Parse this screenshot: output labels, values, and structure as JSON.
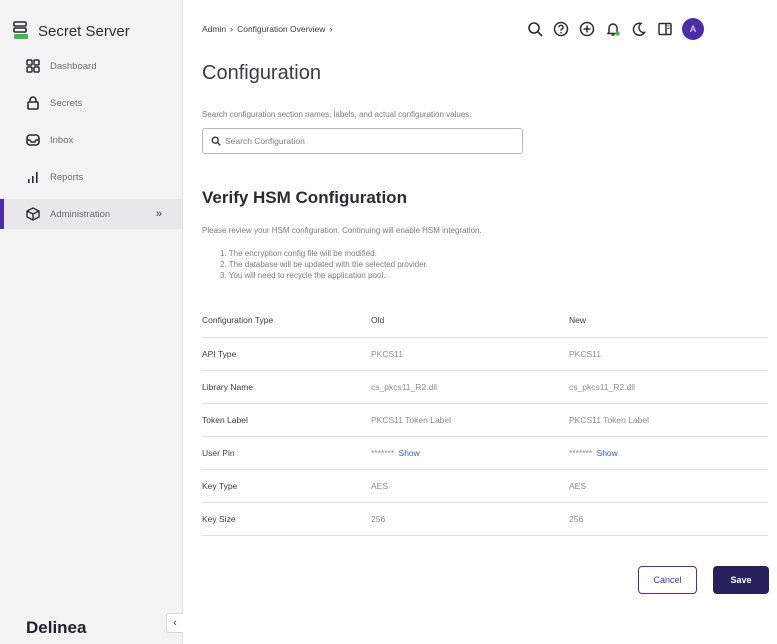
{
  "app": {
    "name": "Secret Server",
    "footer_logo": "Delinea"
  },
  "sidebar": {
    "items": [
      {
        "label": "Dashboard",
        "icon": "dashboard-icon"
      },
      {
        "label": "Secrets",
        "icon": "lock-icon"
      },
      {
        "label": "Inbox",
        "icon": "inbox-icon"
      },
      {
        "label": "Reports",
        "icon": "bar-chart-icon"
      },
      {
        "label": "Administration",
        "icon": "cube-icon",
        "active": true,
        "chevron": "»"
      }
    ],
    "collapse_label": "‹"
  },
  "breadcrumb": [
    "Admin",
    "Configuration Overview"
  ],
  "header": {
    "avatar_initial": "A"
  },
  "page": {
    "title": "Configuration",
    "search_description": "Search configuration section names, labels, and actual configuration values.",
    "search_placeholder": "Search Configuration"
  },
  "hsm": {
    "title": "Verify HSM Configuration",
    "description": "Please review your HSM configuration. Continuing will enable HSM integration.",
    "steps": [
      "1. The encryption config file will be modified.",
      "2. The database will be updated with the selected provider.",
      "3. You will need to recycle the application pool."
    ],
    "table": {
      "headers": [
        "Configuration Type",
        "Old",
        "New"
      ],
      "rows": [
        {
          "key": "API Type",
          "old": "PKCS11",
          "new": "PKCS11"
        },
        {
          "key": "Library Name",
          "old": "cs_pkcs11_R2.dll",
          "new": "cs_pkcs11_R2.dll"
        },
        {
          "key": "Token Label",
          "old": "PKCS11 Token Label",
          "new": "PKCS11 Token Label"
        },
        {
          "key": "User Pin",
          "old": "*******",
          "new": "*******",
          "show_label": "Show"
        },
        {
          "key": "Key Type",
          "old": "AES",
          "new": "AES"
        },
        {
          "key": "Key Size",
          "old": "256",
          "new": "256"
        }
      ]
    }
  },
  "actions": {
    "cancel": "Cancel",
    "save": "Save"
  },
  "colors": {
    "accent": "#4d2ca8",
    "primary_button": "#26215a",
    "link": "#2f5cc6"
  }
}
